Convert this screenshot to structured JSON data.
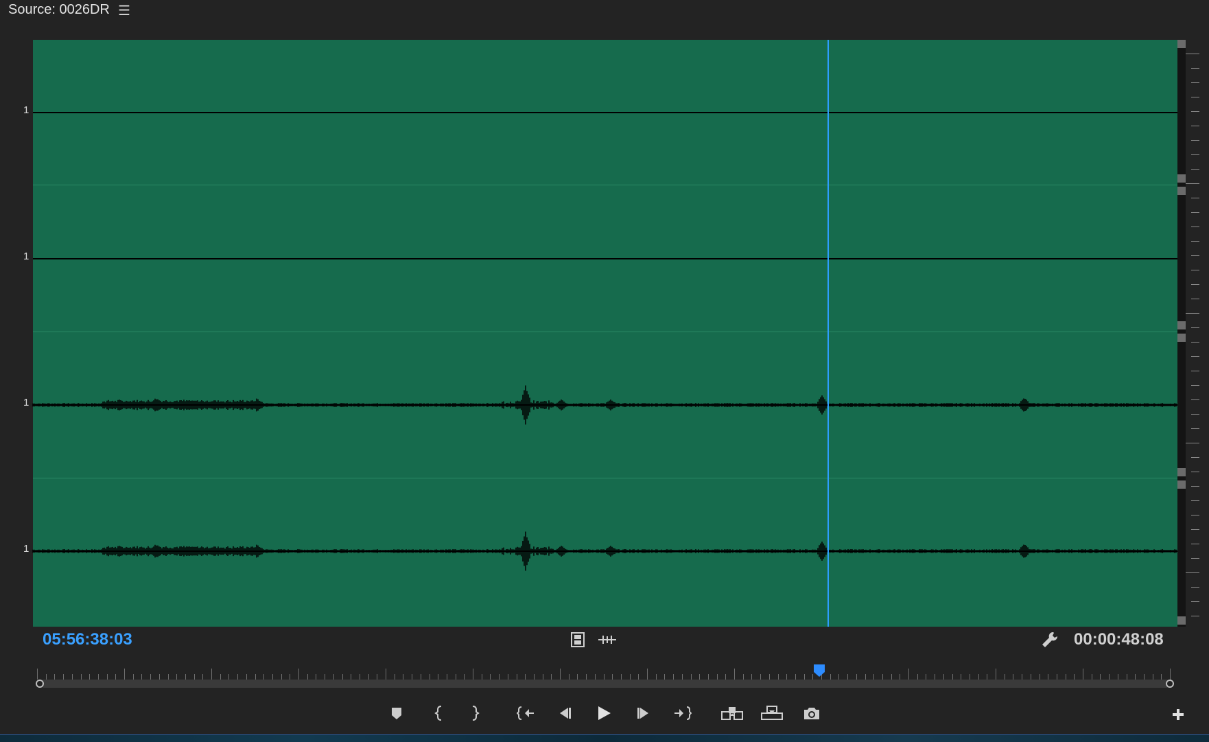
{
  "header": {
    "title": "Source: 0026DR",
    "menu_icon": "hamburger-menu-icon"
  },
  "lanes": [
    {
      "label": "1",
      "has_waveform": false
    },
    {
      "label": "1",
      "has_waveform": false
    },
    {
      "label": "1",
      "has_waveform": true
    },
    {
      "label": "1",
      "has_waveform": true
    }
  ],
  "timecode": {
    "current": "05:56:38:03",
    "duration": "00:00:48:08"
  },
  "toolbar_icons": [
    "film-strip-icon",
    "audio-waveform-toggle-icon",
    "wrench-settings-icon"
  ],
  "playback_controls": [
    "add-marker-button",
    "mark-in-button",
    "mark-out-button",
    "go-to-in-button",
    "step-back-button",
    "play-button",
    "step-forward-button",
    "go-to-out-button",
    "insert-button",
    "overwrite-button",
    "export-frame-button"
  ],
  "colors": {
    "waveform_bg": "#166b4d",
    "accent": "#2d9dff",
    "panel_bg": "#232323"
  }
}
